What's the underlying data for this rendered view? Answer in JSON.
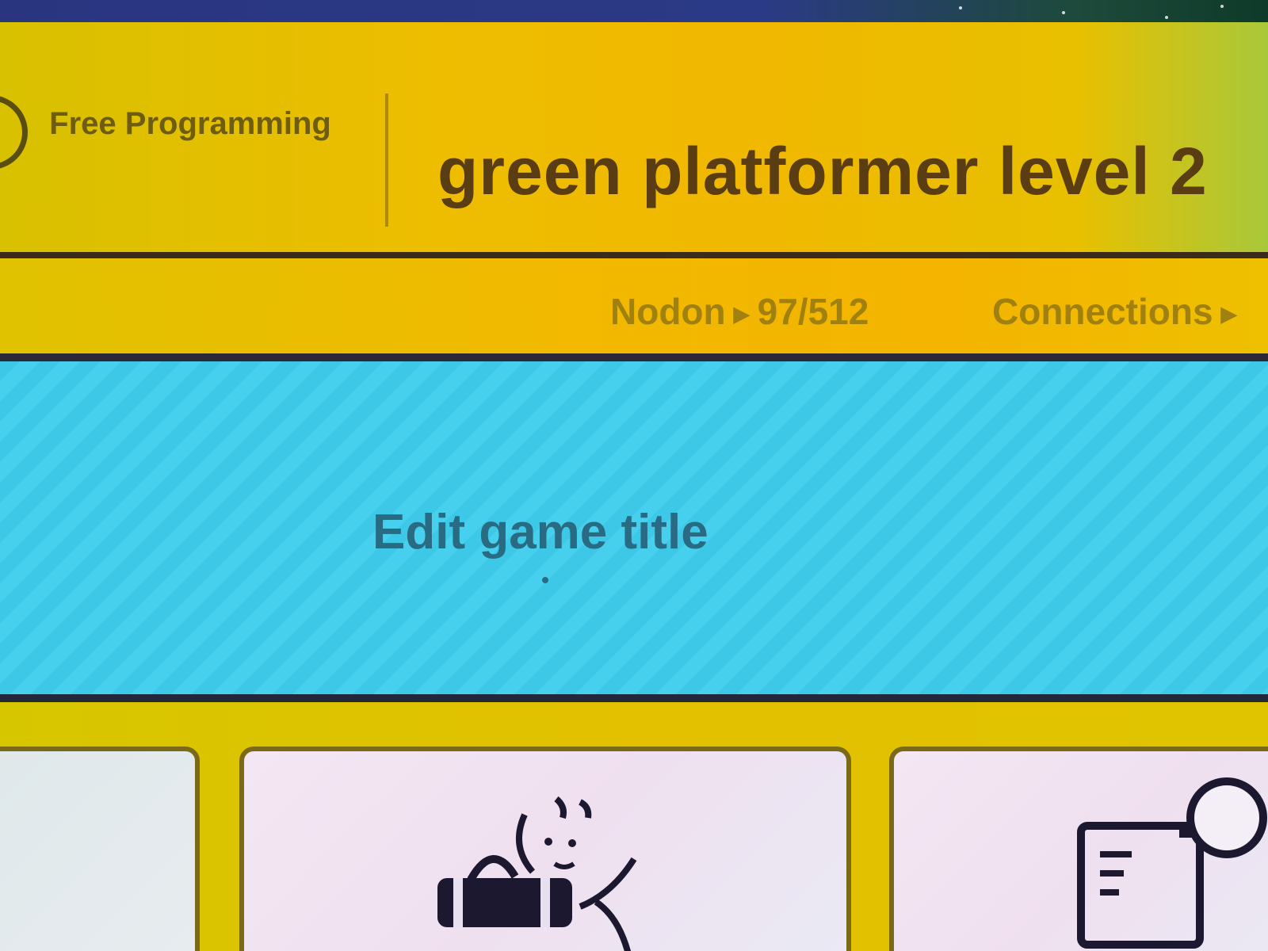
{
  "header": {
    "mode_label": "Free Programming",
    "game_title": "green platformer level 2"
  },
  "stats": {
    "nodon_label": "Nodon",
    "nodon_value": "97/512",
    "connections_label": "Connections"
  },
  "title_editor": {
    "label": "Edit game title"
  },
  "cards": [
    {
      "icon": "blank-card-icon"
    },
    {
      "icon": "nodon-character-icon"
    },
    {
      "icon": "guide-book-icon"
    }
  ],
  "colors": {
    "header_yellow": "#f0b800",
    "title_blue": "#3ec8e8",
    "text_brown": "#5a3d12"
  }
}
